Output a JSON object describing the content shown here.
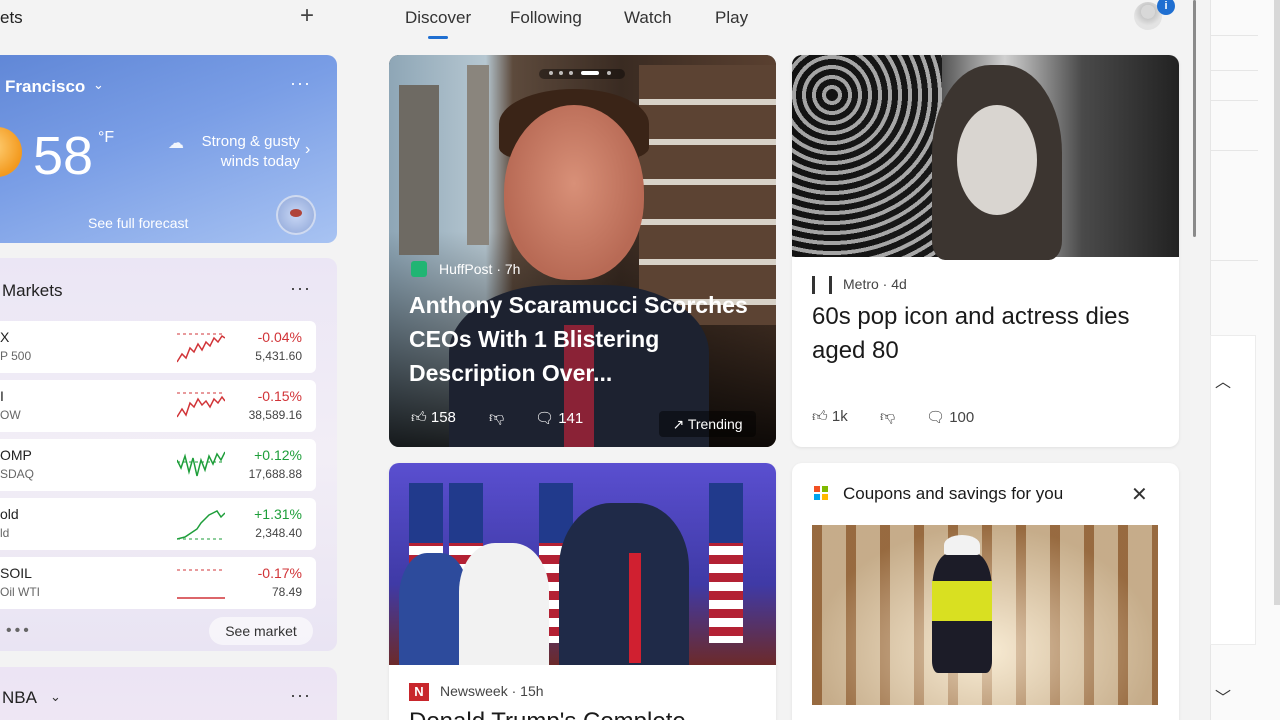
{
  "widgets": {
    "title": "ets",
    "add_icon": "plus-icon"
  },
  "weather": {
    "city": "Francisco",
    "temperature": "58",
    "unit": "°F",
    "condition": "Strong & gusty winds today",
    "forecast_link": "See full forecast",
    "more_icon": "ellipsis-icon"
  },
  "markets": {
    "title": "Markets",
    "see_market": "See market",
    "rows": [
      {
        "symbol": "X",
        "index": "P 500",
        "change": "-0.04%",
        "value": "5,431.60",
        "direction": "down"
      },
      {
        "symbol": "I",
        "index": "OW",
        "change": "-0.15%",
        "value": "38,589.16",
        "direction": "down"
      },
      {
        "symbol": "OMP",
        "index": "SDAQ",
        "change": "+0.12%",
        "value": "17,688.88",
        "direction": "up"
      },
      {
        "symbol": "old",
        "index": "ld",
        "change": "+1.31%",
        "value": "2,348.40",
        "direction": "up"
      },
      {
        "symbol": "SOIL",
        "index": "Oil WTI",
        "change": "-0.17%",
        "value": "78.49",
        "direction": "down"
      }
    ]
  },
  "nba": {
    "title": "NBA"
  },
  "tabs": [
    {
      "label": "Discover",
      "active": true
    },
    {
      "label": "Following",
      "active": false
    },
    {
      "label": "Watch",
      "active": false
    },
    {
      "label": "Play",
      "active": false
    }
  ],
  "profile": {
    "badge": "i"
  },
  "cards": {
    "scaramucci": {
      "source": "HuffPost",
      "age": "7h",
      "headline": "Anthony Scaramucci Scorches CEOs With 1 Blistering Description Over...",
      "likes": "158",
      "comments": "141",
      "trending": "Trending"
    },
    "metro": {
      "source": "Metro",
      "age": "4d",
      "headline": "60s pop icon and actress dies aged 80",
      "likes": "1k",
      "comments": "100"
    },
    "newsweek": {
      "source": "Newsweek",
      "age": "15h",
      "logo_letter": "N",
      "headline": "Donald Trump's Complete..."
    },
    "coupons": {
      "title": "Coupons and savings for you"
    }
  },
  "colors": {
    "accent": "#1f6fd1",
    "up": "#1e9e3a",
    "down": "#d13438",
    "weather_bg": "#6f94de",
    "markets_bg": "#eee9f5"
  }
}
